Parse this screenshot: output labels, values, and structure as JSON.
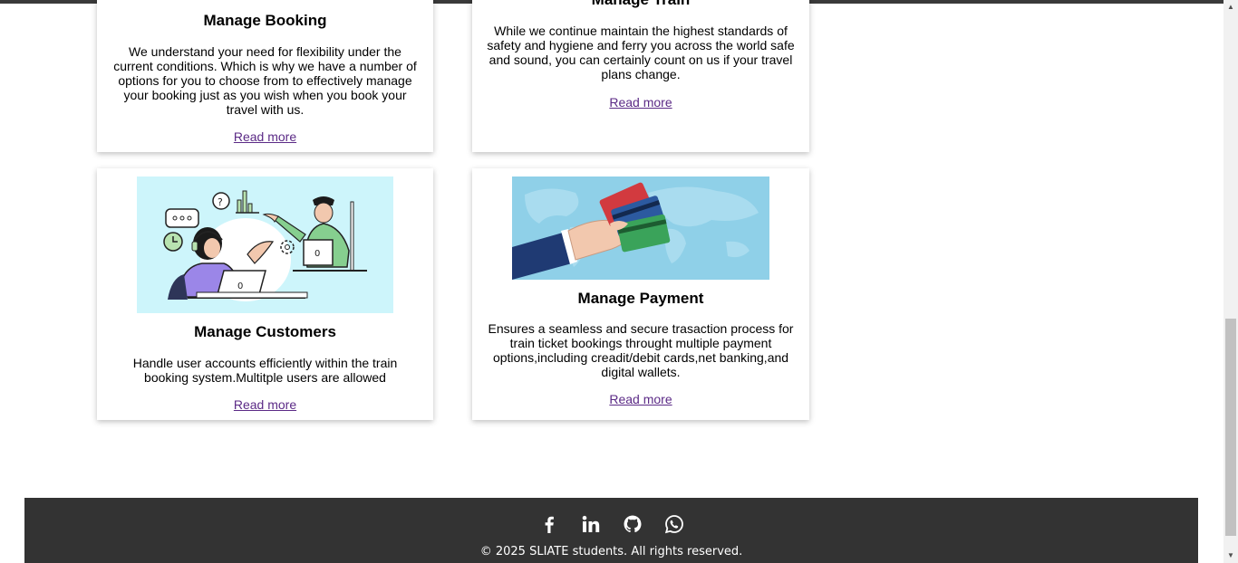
{
  "cards": {
    "booking": {
      "title": "Manage Booking",
      "description": "We understand your need for flexibility under the current conditions. Which is why we have a number of options for you to choose from to effectively manage your booking just as you wish when you book your travel with us.",
      "link": "Read more"
    },
    "train": {
      "title": "Manage Train",
      "description": "While we continue maintain the highest standards of safety and hygiene and ferry you across the world safe and sound, you can certainly count on us if your travel plans change.",
      "link": "Read more"
    },
    "customers": {
      "title": "Manage Customers",
      "description": "Handle user accounts efficiently within the train booking system.Multitple users are allowed",
      "link": "Read more"
    },
    "payment": {
      "title": "Manage Payment",
      "description": "Ensures a seamless and secure trasaction process for train ticket bookings throught multiple payment options,including creadit/debit cards,net banking,and digital wallets.",
      "link": "Read more"
    }
  },
  "footer": {
    "socials": [
      "facebook-icon",
      "linkedin-icon",
      "github-icon",
      "whatsapp-icon"
    ],
    "copyright": "© 2025 SLIATE students. All rights reserved."
  },
  "colors": {
    "link": "#5b2a86",
    "footer_bg": "#333333",
    "customers_image_bg": "#cdf5fb",
    "payment_image_bg": "#8fd0e8"
  }
}
